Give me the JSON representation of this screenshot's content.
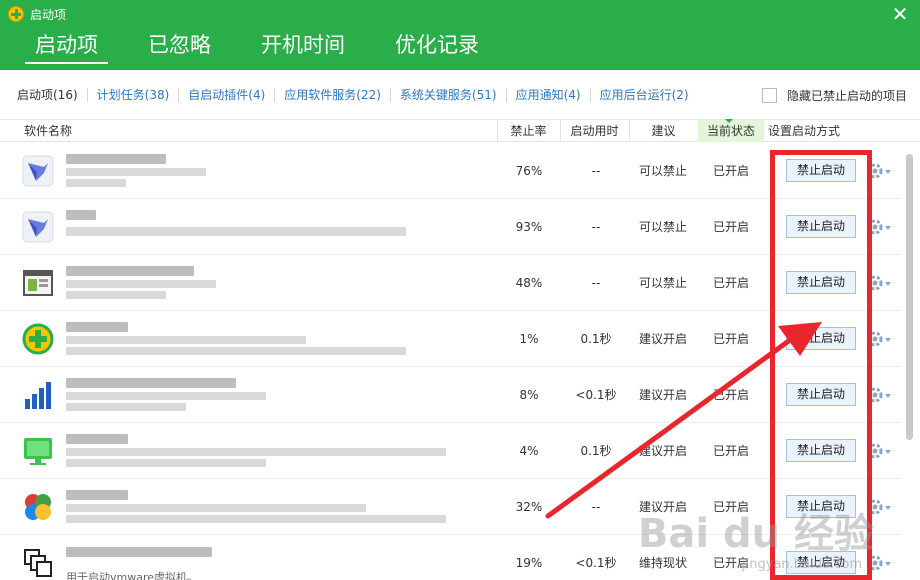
{
  "window": {
    "title": "启动项",
    "close_glyph": "✕"
  },
  "main_tabs": [
    {
      "label": "启动项",
      "active": true
    },
    {
      "label": "已忽略",
      "active": false
    },
    {
      "label": "开机时间",
      "active": false
    },
    {
      "label": "优化记录",
      "active": false
    }
  ],
  "sub_tabs": [
    {
      "label": "启动项(16)",
      "active": true
    },
    {
      "label": "计划任务(38)"
    },
    {
      "label": "自启动插件(4)"
    },
    {
      "label": "应用软件服务(22)"
    },
    {
      "label": "系统关键服务(51)"
    },
    {
      "label": "应用通知(4)"
    },
    {
      "label": "应用后台运行(2)"
    }
  ],
  "hide_disabled": {
    "label": "隐藏已禁止启动的项目",
    "checked": false
  },
  "columns": {
    "name": "软件名称",
    "rate": "禁止率",
    "time": "启动用时",
    "suggest": "建议",
    "status": "当前状态",
    "method": "设置启动方式"
  },
  "rows": [
    {
      "icon": "bird-icon",
      "rate": "76%",
      "time": "--",
      "suggest": "可以禁止",
      "status": "已开启",
      "action": "禁止启动",
      "desc": ""
    },
    {
      "icon": "bird-icon",
      "rate": "93%",
      "time": "--",
      "suggest": "可以禁止",
      "status": "已开启",
      "action": "禁止启动",
      "desc": ""
    },
    {
      "icon": "window-icon",
      "rate": "48%",
      "time": "--",
      "suggest": "可以禁止",
      "status": "已开启",
      "action": "禁止启动",
      "desc": ""
    },
    {
      "icon": "plus-shield-icon",
      "rate": "1%",
      "time": "0.1秒",
      "suggest": "建议开启",
      "status": "已开启",
      "action": "禁止启动",
      "desc": ""
    },
    {
      "icon": "bar-chart-icon",
      "rate": "8%",
      "time": "<0.1秒",
      "suggest": "建议开启",
      "status": "已开启",
      "action": "禁止启动",
      "desc": ""
    },
    {
      "icon": "monitor-icon",
      "rate": "4%",
      "time": "0.1秒",
      "suggest": "建议开启",
      "status": "已开启",
      "action": "禁止启动",
      "desc": ""
    },
    {
      "icon": "colorful-circles-icon",
      "rate": "32%",
      "time": "--",
      "suggest": "建议开启",
      "status": "已开启",
      "action": "禁止启动",
      "desc": ""
    },
    {
      "icon": "vmware-icon",
      "rate": "19%",
      "time": "<0.1秒",
      "suggest": "维持现状",
      "status": "已开启",
      "action": "禁止启动",
      "desc": "用于启动vmware虚拟机。"
    }
  ],
  "watermark": {
    "text": "Bai du 经验",
    "sub": "jingyan.baidu.com"
  },
  "colors": {
    "header": "#2aae4a",
    "annotation": "#e8262b",
    "link": "#2b78c5"
  }
}
